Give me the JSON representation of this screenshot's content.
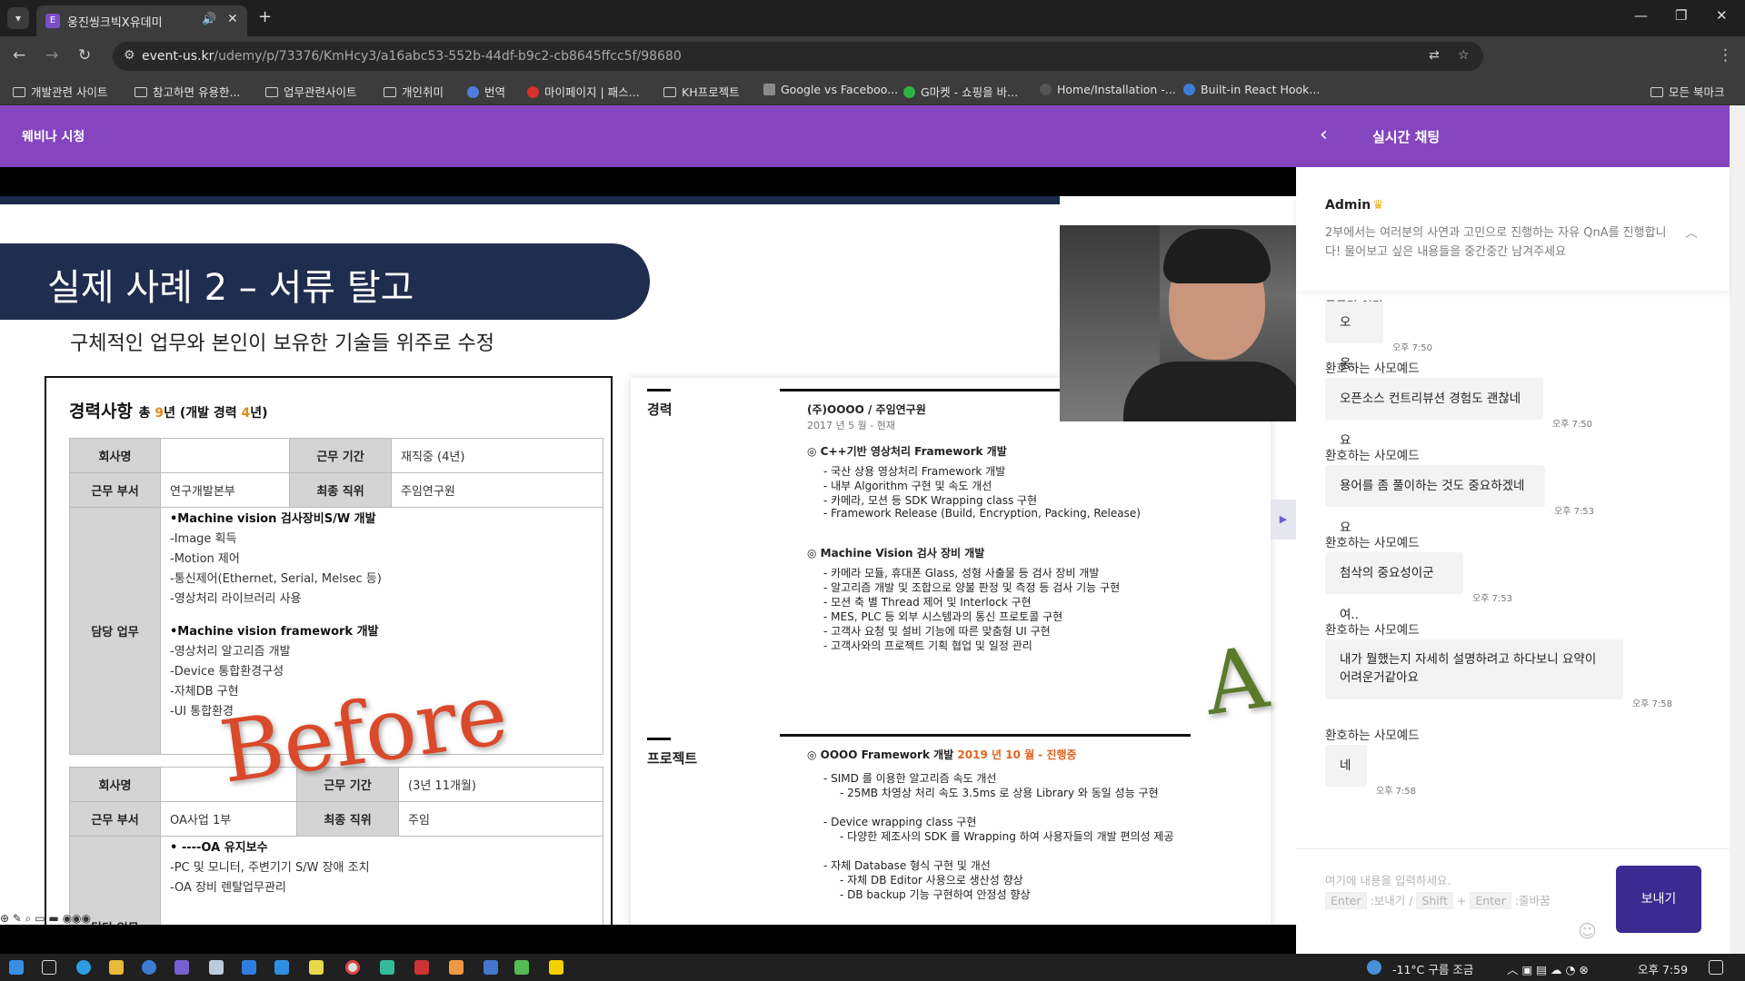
{
  "browser": {
    "tab_title": "웅진씽크빅X유데미",
    "url_host": "event-us.kr",
    "url_path": "/udemy/p/73376/KmHcy3/a16abc53-552b-44df-b9c2-cb8645ffcc5f/98680",
    "bookmarks": [
      "개발관련 사이트",
      "참고하면 유용한...",
      "업무관련사이트",
      "개인취미",
      "번역",
      "마이페이지 | 패스...",
      "KH프로젝트",
      "Google vs Faceboo...",
      "G마켓 - 쇼핑을 바...",
      "Home/Installation -...",
      "Built-in React Hook..."
    ],
    "all_bookmarks": "모든 북마크"
  },
  "header": {
    "webinar_title": "웨비나 시청",
    "chat_title": "실시간 채팅"
  },
  "slide": {
    "title": "실제 사례 2 – 서류 탈고",
    "subtitle": "구체적인 업무와 본인이 보유한 기술들 위주로 수정",
    "career_heading": "경력사항",
    "career_summary_pre": "총",
    "career_total": "9",
    "career_summary_mid": "년 (개발 경력",
    "career_dev": "4",
    "career_summary_post": "년)",
    "t1": {
      "company_label": "회사명",
      "company_value": "",
      "period_label": "근무 기간",
      "period_value": "재직중 (4년)",
      "dept_label": "근무 부서",
      "dept_value": "연구개발본부",
      "position_label": "최종 직위",
      "position_value": "주임연구원",
      "duty_label": "담당 업무",
      "duties": [
        {
          "text": "•Machine vision 검사장비S/W 개발",
          "bold": true
        },
        {
          "text": "-Image 획득",
          "bold": false
        },
        {
          "text": "-Motion 제어",
          "bold": false
        },
        {
          "text": "-통신제어(Ethernet, Serial, Melsec 등)",
          "bold": false
        },
        {
          "text": "-영상처리 라이브러리 사용",
          "bold": false
        },
        {
          "text": "•Machine vision framework 개발",
          "bold": true
        },
        {
          "text": "-영상처리 알고리즘 개발",
          "bold": false
        },
        {
          "text": "-Device 통합환경구성",
          "bold": false
        },
        {
          "text": "-자체DB 구현",
          "bold": false
        },
        {
          "text": "-UI 통합환경",
          "bold": false
        }
      ]
    },
    "t2": {
      "company_label": "회사명",
      "period_label": "근무 기간",
      "period_value": "(3년 11개월)",
      "dept_label": "근무 부서",
      "dept_value": "OA사업 1부",
      "position_label": "최종 직위",
      "position_value": "주임",
      "duty_label": "담당 업무",
      "duties": [
        {
          "text": "• ----OA 유지보수",
          "bold": true
        },
        {
          "text": "-PC 및 모니터, 주변기기 S/W 장애 조치",
          "bold": false
        },
        {
          "text": "-OA 장비 렌탈업무관리",
          "bold": false
        }
      ]
    },
    "before_label": "Before",
    "after_label": "A",
    "right": {
      "sec_career": "경력",
      "sec_project": "프로젝트",
      "company": "(주)OOOO / 주임연구원",
      "period": "2017 년 5 월 - 현재",
      "lines": [
        {
          "text": "◎ C++기반 영상처리  Framework 개발",
          "cls": "b"
        },
        {
          "text": "-     국산 상용 영상처리 Framework 개발",
          "cls": ""
        },
        {
          "text": "-     내부 Algorithm 구현 및 속도 개선",
          "cls": ""
        },
        {
          "text": "-     카메라, 모션 등 SDK Wrapping class 구현",
          "cls": ""
        },
        {
          "text": "-     Framework Release (Build, Encryption,  Packing, Release)",
          "cls": ""
        },
        {
          "text": "◎ Machine Vision 검사 장비 개발",
          "cls": "b"
        },
        {
          "text": "-     카메라 모듈, 휴대폰 Glass, 성형 사출물 등 검사 장비 개발",
          "cls": ""
        },
        {
          "text": "-     알고리즘 개발 및 조합으로 양불 판정 및 측정 등 검사 기능 구현",
          "cls": ""
        },
        {
          "text": "-     모션 축 별 Thread 제어 및 Interlock 구현",
          "cls": ""
        },
        {
          "text": "-     MES, PLC 등 외부 시스템과의 통신 프로토콜 구현",
          "cls": ""
        },
        {
          "text": "-     고객사 요청 및 설비 기능에 따른 맞춤형 UI 구현",
          "cls": ""
        },
        {
          "text": "-     고객사와의 프로젝트 기획 협업 및 일정 관리",
          "cls": ""
        }
      ],
      "project_title": "◎ OOOO Framework 개발",
      "project_date": "2019 년 10 월 - 진행중",
      "project_lines": [
        "-     SIMD 를 이용한 알고리즘 속도 개선",
        "-     25MB 차영상 처리 속도 3.5ms 로 상용 Library 와 동일 성능 구현",
        "-     Device wrapping class 구현",
        "-     다양한 제조사의 SDK 를 Wrapping 하여 사용자들의 개발 편의성 제공",
        "-     자체 Database 형식 구현 및 개선",
        "-     자체 DB Editor 사용으로 생산성 향상",
        "-     DB backup 기능 구현하여 안정성 향상"
      ]
    }
  },
  "chat": {
    "pinned_author": "Admin",
    "pinned_text": "2부에서는 여러분의 사연과 고민으로 진행하는 자유 QnA를 진행합니다! 물어보고 싶은 내용들을 중간중간 남겨주세요",
    "cut_text": "풍풍만 인다",
    "messages": [
      {
        "author": "",
        "text": "오옹..",
        "time": "오후 7:50"
      },
      {
        "author": "환호하는 사모예드",
        "text": "오픈소스 컨트리뷰션 경험도 괜찮네요",
        "time": "오후 7:50"
      },
      {
        "author": "환호하는 사모예드",
        "text": "용어를 좀 풀이하는 것도 중요하겠네요",
        "time": "오후 7:53"
      },
      {
        "author": "환호하는 사모예드",
        "text": "첨삭의 중요성이군여..",
        "time": "오후 7:53"
      },
      {
        "author": "환호하는 사모예드",
        "text": "내가 뭘했는지 자세히 설명하려고 하다보니 요약이 어려운거같아요",
        "time": "오후 7:58"
      },
      {
        "author": "환호하는 사모예드",
        "text": "네",
        "time": "오후 7:58"
      }
    ],
    "input_placeholder": "여기에 내용을 입력하세요.",
    "hint_enter": "Enter",
    "hint_send": ":보내기 /",
    "hint_shift": "Shift",
    "hint_plus": "+",
    "hint_enter2": "Enter",
    "hint_newline": ":줄바꿈",
    "send_label": "보내기"
  },
  "taskbar": {
    "weather": "-11°C  구름 조금",
    "clock": "오후 7:59"
  }
}
